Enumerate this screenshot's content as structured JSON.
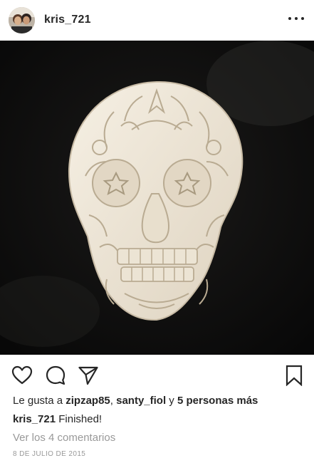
{
  "header": {
    "username": "kris_721",
    "avatar_icon": "avatar-photo",
    "more_icon": "more-options-icon"
  },
  "photo": {
    "description_icon": "sugar-skull-carving",
    "background_color": "#0d0c0c",
    "subject_color": "#efe7d9"
  },
  "actions": {
    "like_icon": "heart-icon",
    "comment_icon": "comment-icon",
    "share_icon": "send-icon",
    "save_icon": "bookmark-icon"
  },
  "likes": {
    "prefix": "Le gusta a ",
    "user1": "zipzap85",
    "separator": ", ",
    "user2": "santy_fiol",
    "conjunction": " y ",
    "others": "5 personas más"
  },
  "caption": {
    "username": "kris_721",
    "text": " Finished!"
  },
  "comments": {
    "view_all": "Ver los 4 comentarios"
  },
  "date": "8 DE JULIO DE 2015"
}
